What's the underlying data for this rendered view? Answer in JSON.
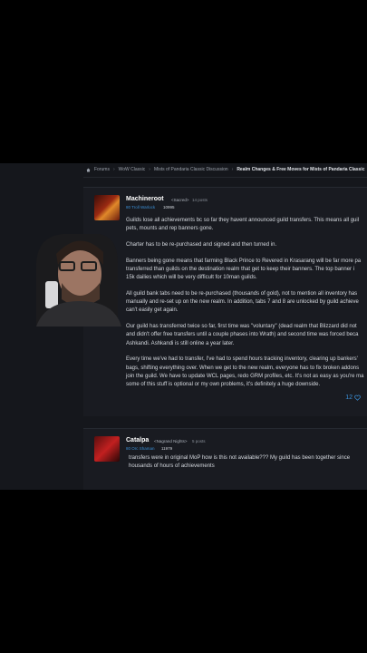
{
  "breadcrumb": {
    "items": [
      "Forums",
      "WoW Classic",
      "Mists of Pandaria Classic Discussion"
    ],
    "current": "Realm Changes & Free Moves for Mists of Pandaria Classic"
  },
  "posts": [
    {
      "username": "Machineroot",
      "guild": "<Sacred>",
      "post_count": "14 posts",
      "class_line": "80 Troll Warlock",
      "item_level": "10995",
      "paragraphs": [
        "Guilds lose all achievements bc so far they havent announced guild transfers. This means all guil",
        "pets, mounts and rep banners gone.",
        "Charter has to be re-purchased and signed and then turned in.",
        "Banners being gone means that farming Black Prince to Revered in Krasarang will be far more pa",
        "transferred than guilds on the destination realm that get to keep their banners. The top banner i",
        "15k dailies which will be very difficult for 10man guilds.",
        "All guild bank tabs need to be re-purchased (thousands of gold), not to mention all inventory has",
        "manually and re-set up on the new realm. In addition, tabs 7 and 8 are unlocked by guild achieve",
        "can't easily get again.",
        "Our guild has transferred twice so far, first time was \"voluntary\" (dead realm that Blizzard did not",
        "and didn't offer free transfers until a couple phases into Wrath) and second time was forced beca",
        "Ashkandi. Ashkandi is still online a year later.",
        "Every time we've had to transfer, I've had to spend hours tracking inventory, clearing up bankers'",
        "bags, shifting everything over. When we get to the new realm, everyone has to fix broken addons",
        "join the guild. We have to update WCL pages, redo GRM profiles, etc. It's not as easy as you're ma",
        "some of this stuff is optional or my own problems, it's definitely a huge downside."
      ],
      "likes": "12"
    },
    {
      "username": "Catalpa",
      "guild": "<Nagrand Nights>",
      "post_count": "5 posts",
      "class_line": "80 Orc Shaman",
      "item_level": "11979",
      "lines": [
        "transfers were in original MoP how is this not available??? My guild has been together since",
        "housands of hours of achievements"
      ]
    }
  ],
  "colors": {
    "accent": "#3b8fd6",
    "background": "#15171c"
  },
  "icons": {
    "home": "home-icon",
    "like": "heart-icon"
  }
}
